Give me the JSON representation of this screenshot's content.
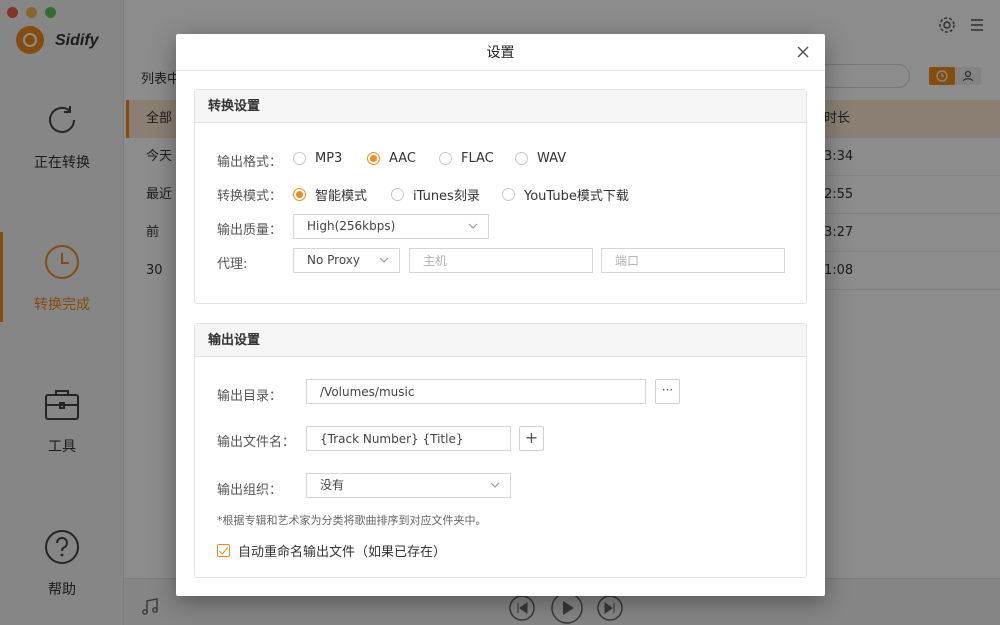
{
  "app": {
    "brand": "Sidify",
    "traffic_colors": [
      "#ee5c54",
      "#f5bd4f",
      "#62c655"
    ],
    "accent": "#f08c1c"
  },
  "sidebar": {
    "items": [
      {
        "label": "正在转换",
        "icon": "refresh-icon"
      },
      {
        "label": "转换完成",
        "icon": "clock-icon",
        "active": true
      },
      {
        "label": "工具",
        "icon": "toolbox-icon"
      },
      {
        "label": "帮助",
        "icon": "help-icon"
      }
    ]
  },
  "background": {
    "list_label": "列表中",
    "row_labels": [
      "全部",
      "今天",
      "最近",
      "前 30"
    ],
    "duration_header": "时长",
    "durations": [
      "3:34",
      "2:55",
      "3:27",
      "1:08"
    ]
  },
  "dialog": {
    "title": "设置",
    "conversion": {
      "heading": "转换设置",
      "format_label": "输出格式：",
      "formats": [
        "MP3",
        "AAC",
        "FLAC",
        "WAV"
      ],
      "format_selected": "AAC",
      "mode_label": "转换模式：",
      "modes": [
        "智能模式",
        "iTunes刻录",
        "YouTube模式下载"
      ],
      "mode_selected": "智能模式",
      "quality_label": "输出质量：",
      "quality_value": "High(256kbps)",
      "proxy_label": "代理:",
      "proxy_value": "No Proxy",
      "host_placeholder": "主机",
      "port_placeholder": "端口"
    },
    "output": {
      "heading": "输出设置",
      "dir_label": "输出目录：",
      "dir_value": "/Volumes/music",
      "browse_label": "···",
      "filename_label": "输出文件名：",
      "filename_value": "{Track Number} {Title}",
      "add_label": "+",
      "organize_label": "输出组织：",
      "organize_value": "没有",
      "note": "*根据专辑和艺术家为分类将歌曲排序到对应文件夹中。",
      "rename_label": "自动重命名输出文件（如果已存在）",
      "rename_checked": true
    }
  }
}
